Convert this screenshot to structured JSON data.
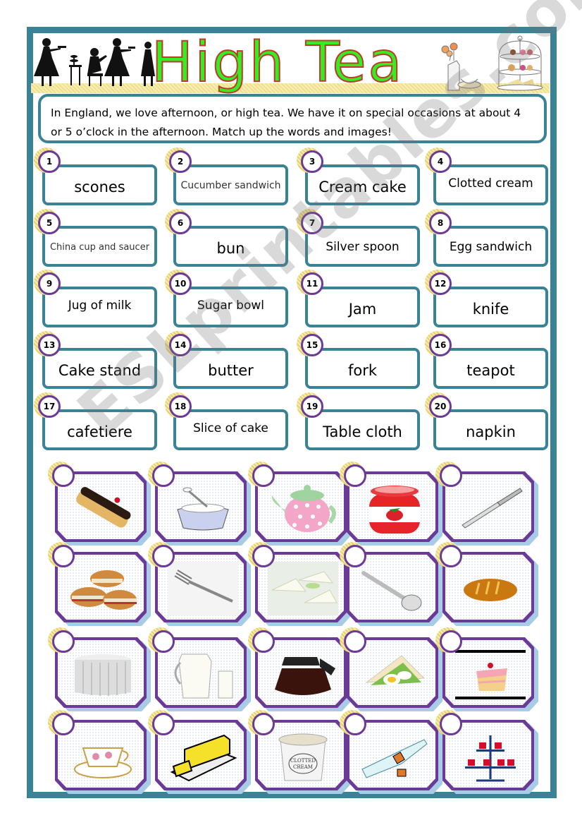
{
  "worksheet": {
    "title": "High Tea",
    "intro": "In England, we love afternoon, or high tea. We have it on special occasions at about 4 or 5 o’clock in the afternoon. Match up the words and images!",
    "watermark": "ESLprintables.com",
    "colors": {
      "frame": "#3a8296",
      "title_fill": "#33ee22",
      "title_outline": "#c0392b",
      "circle_border": "#6b3a96",
      "card_frame": "#6b3a96",
      "card_shadow": "#a8cbe6",
      "halo": "#e8d26a"
    }
  },
  "words": [
    {
      "num": "1",
      "label": "scones"
    },
    {
      "num": "2",
      "label": "Cucumber sandwich"
    },
    {
      "num": "3",
      "label": "Cream cake"
    },
    {
      "num": "4",
      "label": "Clotted cream"
    },
    {
      "num": "5",
      "label": "China cup and saucer"
    },
    {
      "num": "6",
      "label": "bun"
    },
    {
      "num": "7",
      "label": "Silver spoon"
    },
    {
      "num": "8",
      "label": "Egg sandwich"
    },
    {
      "num": "9",
      "label": "Jug of milk"
    },
    {
      "num": "10",
      "label": "Sugar bowl"
    },
    {
      "num": "11",
      "label": "Jam"
    },
    {
      "num": "12",
      "label": "knife"
    },
    {
      "num": "13",
      "label": "Cake stand"
    },
    {
      "num": "14",
      "label": "butter"
    },
    {
      "num": "15",
      "label": "fork"
    },
    {
      "num": "16",
      "label": "teapot"
    },
    {
      "num": "17",
      "label": "cafetiere"
    },
    {
      "num": "18",
      "label": "Slice of cake"
    },
    {
      "num": "19",
      "label": "Table cloth"
    },
    {
      "num": "20",
      "label": "napkin"
    }
  ],
  "images": [
    {
      "icon": "eclair-icon"
    },
    {
      "icon": "sugar-bowl-icon"
    },
    {
      "icon": "teapot-icon"
    },
    {
      "icon": "jam-jar-icon"
    },
    {
      "icon": "knife-icon"
    },
    {
      "icon": "scones-icon"
    },
    {
      "icon": "fork-icon"
    },
    {
      "icon": "cucumber-sandwich-icon"
    },
    {
      "icon": "spoon-icon"
    },
    {
      "icon": "bun-icon"
    },
    {
      "icon": "tablecloth-icon"
    },
    {
      "icon": "milk-jug-icon"
    },
    {
      "icon": "cafetiere-icon"
    },
    {
      "icon": "egg-sandwich-icon"
    },
    {
      "icon": "slice-of-cake-icon"
    },
    {
      "icon": "china-cup-icon"
    },
    {
      "icon": "butter-icon"
    },
    {
      "icon": "clotted-cream-icon"
    },
    {
      "icon": "napkin-icon"
    },
    {
      "icon": "cake-stand-icon"
    }
  ]
}
